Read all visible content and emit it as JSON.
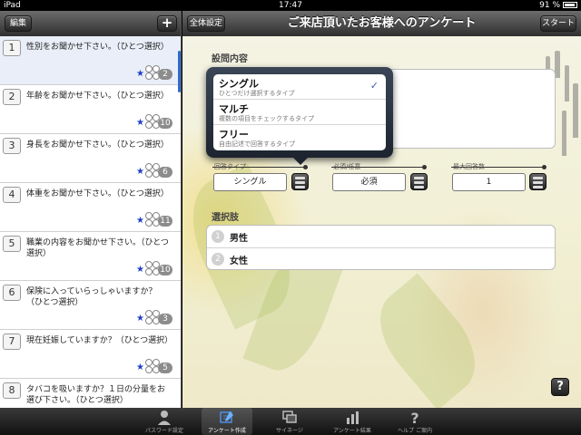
{
  "status_bar": {
    "device": "iPad",
    "time": "17:47",
    "battery": "91 %"
  },
  "left_pane": {
    "edit_label": "編集",
    "add_label": "+",
    "questions": [
      {
        "num": "1",
        "text": "性別をお聞かせ下さい。（ひとつ選択）",
        "count": "2",
        "selected": true
      },
      {
        "num": "2",
        "text": "年齢をお聞かせ下さい。（ひとつ選択）",
        "count": "10"
      },
      {
        "num": "3",
        "text": "身長をお聞かせ下さい。（ひとつ選択）",
        "count": "6"
      },
      {
        "num": "4",
        "text": "体重をお聞かせ下さい。（ひとつ選択）",
        "count": "11"
      },
      {
        "num": "5",
        "text": "職業の内容をお聞かせ下さい。（ひとつ選択）",
        "count": "10"
      },
      {
        "num": "6",
        "text": "保険に入っていらっしゃいますか？（ひとつ選択）",
        "count": "3"
      },
      {
        "num": "7",
        "text": "現在妊娠していますか？（ひとつ選択）",
        "count": "5"
      },
      {
        "num": "8",
        "text": "タバコを吸いますか？１日の分量をお選び下さい。（ひとつ選択）",
        "count": ""
      }
    ]
  },
  "right_pane": {
    "global_settings_label": "全体設定",
    "title": "ご来店頂いたお客様へのアンケート",
    "start_label": "スタート",
    "question_content_label": "設問内容",
    "answer_type_label": "回答タイプ",
    "answer_type_value": "シングル",
    "required_label": "必須/任意",
    "required_value": "必須",
    "max_answers_label": "最大回答数",
    "max_answers_value": "1",
    "choices_label": "選択肢",
    "choices": [
      {
        "num": "1",
        "text": "男性"
      },
      {
        "num": "2",
        "text": "女性"
      }
    ],
    "help_label": "?"
  },
  "popover": {
    "options": [
      {
        "name": "シングル",
        "desc": "ひとつだけ選択するタイプ",
        "checked": true
      },
      {
        "name": "マルチ",
        "desc": "複数の項目をチェックするタイプ",
        "checked": false
      },
      {
        "name": "フリー",
        "desc": "自由記述で回答するタイプ",
        "checked": false
      }
    ],
    "check_mark": "✓"
  },
  "tab_bar": {
    "tabs": [
      {
        "label": "パスワード設定",
        "icon": "person-icon"
      },
      {
        "label": "アンケート作成",
        "icon": "edit-icon",
        "active": true
      },
      {
        "label": "サイネージ",
        "icon": "signage-icon"
      },
      {
        "label": "アンケート結果",
        "icon": "bar-chart-icon"
      },
      {
        "label": "ヘルプ ご案内",
        "icon": "help-icon"
      }
    ]
  },
  "colors": {
    "accent_blue": "#2f6bd1",
    "star_blue": "#2140c4",
    "bar_dark": "#2f2f2f"
  }
}
